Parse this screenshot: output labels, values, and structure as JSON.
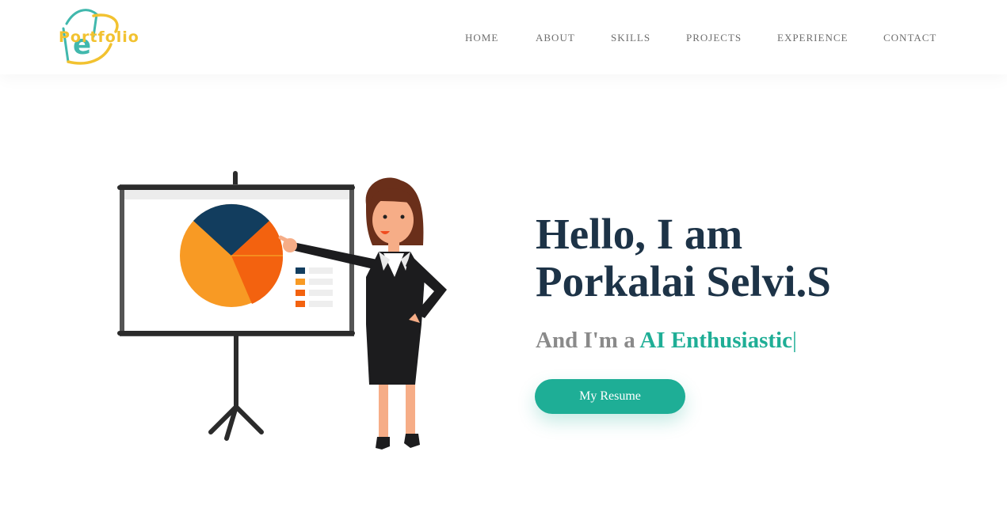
{
  "brand": {
    "logo_letter": "e",
    "logo_text": "Portfolio",
    "colors": {
      "teal": "#41b8ad",
      "yellow": "#f2c230"
    }
  },
  "nav": {
    "items": [
      {
        "label": "HOME"
      },
      {
        "label": "ABOUT"
      },
      {
        "label": "SKILLS"
      },
      {
        "label": "PROJECTS"
      },
      {
        "label": "EXPERIENCE"
      },
      {
        "label": "CONTACT"
      }
    ]
  },
  "hero": {
    "title_line1": "Hello, I am",
    "title_line2": "Porkalai Selvi.S",
    "subtitle_prefix": "And I'm a ",
    "role": "AI Enthusiastic",
    "cursor": "|",
    "resume_label": "My Resume",
    "colors": {
      "title": "#1d3347",
      "accent": "#1eae96",
      "subtitle": "#8a8a8a"
    }
  },
  "illustration": {
    "description_icon": "presentation-woman-icon"
  }
}
